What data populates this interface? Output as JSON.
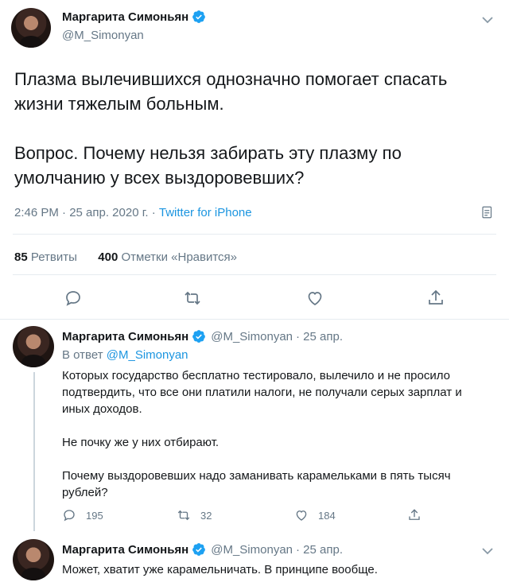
{
  "main_tweet": {
    "display_name": "Маргарита Симоньян",
    "handle": "@M_Simonyan",
    "text": "Плазма вылечившихся однозначно помогает спасать\nжизни тяжелым больным.\n\nВопрос. Почему нельзя забирать эту плазму по\nумолчанию у всех выздоровевших?",
    "time": "2:46 PM · 25 апр. 2020 г. · ",
    "client": "Twitter for iPhone",
    "retweets_count": "85",
    "retweets_label": "Ретвиты",
    "likes_count": "400",
    "likes_label": "Отметки «Нравится»"
  },
  "reply_1": {
    "display_name": "Маргарита Симоньян",
    "handle": "@M_Simonyan",
    "date": "· 25 апр.",
    "reply_prefix": "В ответ ",
    "reply_mention": "@M_Simonyan",
    "text": "Которых государство бесплатно тестировало, вылечило и не просило\nподтвердить, что все они платили налоги, не получали серых зарплат и\nиных доходов.\n\nНе почку же у них отбирают.\n\nПочему выздоровевших надо заманивать карамельками в пять тысяч\nрублей?",
    "replies": "195",
    "retweets": "32",
    "likes": "184"
  },
  "reply_2": {
    "display_name": "Маргарита Симоньян",
    "handle": "@M_Simonyan",
    "date": "· 25 апр.",
    "text": "Может, хватит уже карамельничать. В принципе вообще."
  },
  "icons": {
    "verified": "verified-badge-icon",
    "caret": "chevron-down-icon",
    "analytics": "analytics-icon",
    "reply": "reply-icon",
    "retweet": "retweet-icon",
    "like": "heart-icon",
    "share": "share-icon"
  },
  "colors": {
    "accent": "#1da1f2",
    "link": "#1b95e0",
    "secondary_text": "#657786",
    "primary_text": "#14171a",
    "divider": "#e6ecf0"
  }
}
